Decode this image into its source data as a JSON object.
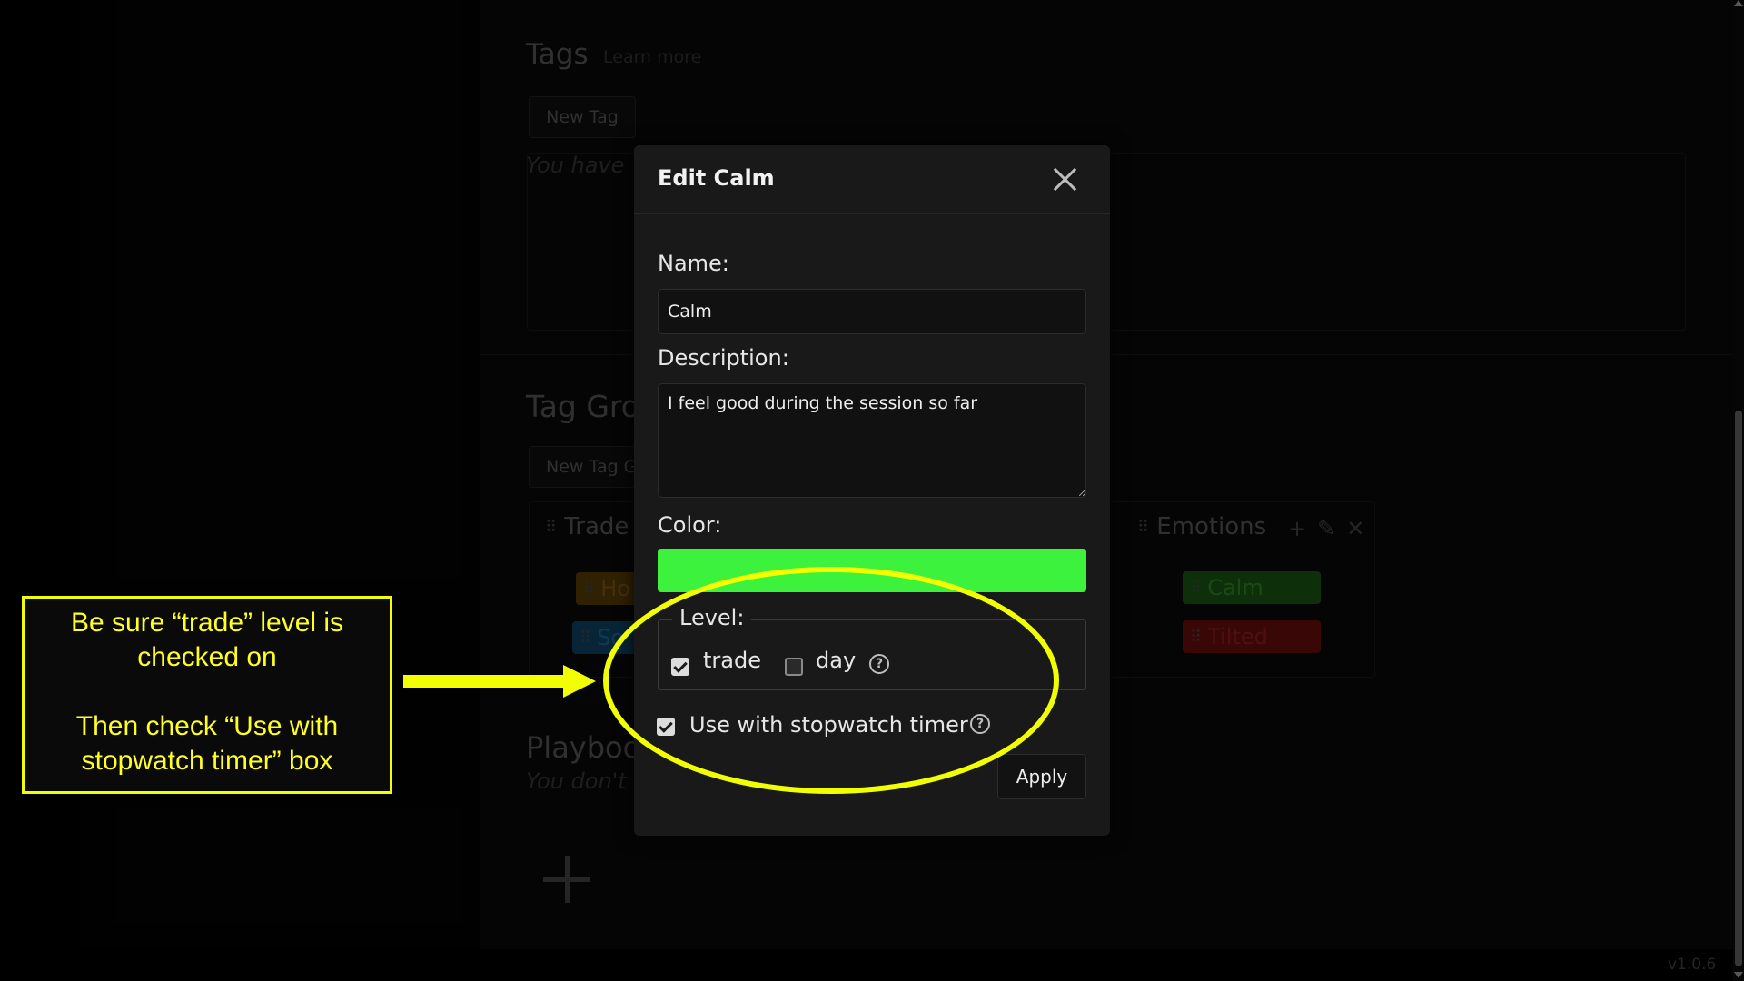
{
  "background": {
    "tags": {
      "title": "Tags",
      "learn_more": "Learn more",
      "new_tag_label": "New Tag",
      "empty_text": "You have"
    },
    "tag_groups": {
      "title": "Tag Gro",
      "new_group_label": "New Tag G",
      "groups": [
        {
          "title": "Trade",
          "chips": [
            {
              "label": "Ho",
              "color": "#4a3306"
            },
            {
              "label": "So",
              "color": "#0c3a55"
            }
          ]
        },
        {
          "title": "Emotions",
          "chips": [
            {
              "label": "Calm",
              "color": "#154a12"
            },
            {
              "label": "Tilted",
              "color": "#5a0c0c"
            }
          ]
        }
      ]
    },
    "playbook": {
      "title": "Playboo",
      "empty_text": "You don't"
    },
    "version": "v1.0.6"
  },
  "modal": {
    "title": "Edit Calm",
    "name_label": "Name:",
    "name_value": "Calm",
    "description_label": "Description:",
    "description_value": "I feel good during the session so far",
    "color_label": "Color:",
    "color_value": "#3cf23c",
    "level_label": "Level:",
    "level_options": [
      {
        "label": "trade",
        "checked": true
      },
      {
        "label": "day",
        "checked": false
      }
    ],
    "stopwatch_label": "Use with stopwatch timer",
    "stopwatch_checked": true,
    "help_glyph": "?",
    "apply_label": "Apply"
  },
  "annotation": {
    "line1": "Be sure “trade” level is checked on",
    "line2": "Then check “Use with stopwatch timer” box",
    "highlight_color": "#f2ff00"
  }
}
